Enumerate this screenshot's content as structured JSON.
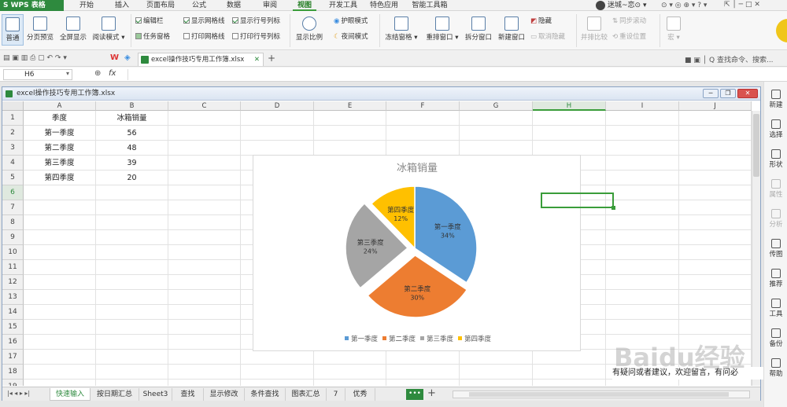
{
  "app": {
    "logo": "S WPS 表格"
  },
  "menus": [
    "开始",
    "插入",
    "页面布局",
    "公式",
    "数据",
    "审阅",
    "视图",
    "开发工具",
    "特色应用",
    "智能工具箱"
  ],
  "active_menu": "视图",
  "user": "迷城~恋⊙ ▾",
  "ribbon": {
    "normal": "普通",
    "page_preview": "分页预览",
    "full_screen": "全屏显示",
    "reading_mode": "阅读模式 ▾",
    "edit_bar": "编辑栏",
    "task_pane": "任务窗格",
    "show_gridlines": "显示网格线",
    "print_gridlines": "打印网格线",
    "show_rowcol_headers": "显示行号列标",
    "print_rowcol_headers": "打印行号列标",
    "zoom": "显示比例",
    "eye_mode": "护眼模式",
    "night_mode": "夜间模式",
    "freeze": "冻结窗格 ▾",
    "arrange": "重排窗口 ▾",
    "split": "拆分窗口",
    "new_window": "新建窗口",
    "hide": "隐藏",
    "unhide": "取消隐藏",
    "side_by_side": "并排比较",
    "sync_scroll": "同步滚动",
    "reset_position": "重设位置",
    "macro": "宏 ▾"
  },
  "doc_tab": "excel操作技巧专用工作簿.xlsx",
  "search_placeholder": "Q 查找命令、搜索...",
  "name_box": "H6",
  "fx": "fx",
  "window_title": "excel操作技巧专用工作簿.xlsx",
  "columns": [
    "A",
    "B",
    "C",
    "D",
    "E",
    "F",
    "G",
    "H",
    "I",
    "J"
  ],
  "rows": [
    "1",
    "2",
    "3",
    "4",
    "5",
    "6",
    "7",
    "8",
    "9",
    "10",
    "11",
    "12",
    "13",
    "14",
    "15",
    "16",
    "17",
    "18",
    "19"
  ],
  "table": {
    "headers": [
      "季度",
      "冰箱销量"
    ],
    "data": [
      [
        "第一季度",
        "56"
      ],
      [
        "第二季度",
        "48"
      ],
      [
        "第三季度",
        "39"
      ],
      [
        "第四季度",
        "20"
      ]
    ]
  },
  "chart_data": {
    "type": "pie",
    "title": "冰箱销量",
    "categories": [
      "第一季度",
      "第二季度",
      "第三季度",
      "第四季度"
    ],
    "values": [
      56,
      48,
      39,
      20
    ],
    "labels": [
      "34%",
      "30%",
      "24%",
      "12%"
    ],
    "colors": [
      "#5b9bd5",
      "#ed7d31",
      "#a5a5a5",
      "#ffc000"
    ],
    "legend": "bottom",
    "exploded": [
      false,
      true,
      true,
      false
    ]
  },
  "sheets": [
    "快速输入",
    "按日期汇总",
    "Sheet3",
    "查找",
    "显示修改",
    "条件查找",
    "图表汇总",
    "7",
    "优秀"
  ],
  "active_sheet": "快速输入",
  "right_panel": [
    {
      "label": "新建",
      "icon": "new-icon"
    },
    {
      "label": "选择",
      "icon": "select-icon"
    },
    {
      "label": "形状",
      "icon": "shape-icon"
    },
    {
      "label": "属性",
      "icon": "property-icon"
    },
    {
      "label": "分析",
      "icon": "analysis-icon"
    },
    {
      "label": "传图",
      "icon": "upload-image-icon"
    },
    {
      "label": "推荐",
      "icon": "recommend-icon"
    },
    {
      "label": "工具",
      "icon": "tools-icon"
    },
    {
      "label": "备份",
      "icon": "backup-icon"
    },
    {
      "label": "帮助",
      "icon": "help-icon"
    }
  ],
  "overlay_text": "有疑问或者建议，欢迎留言，有问必",
  "watermark": "Baidu经验"
}
